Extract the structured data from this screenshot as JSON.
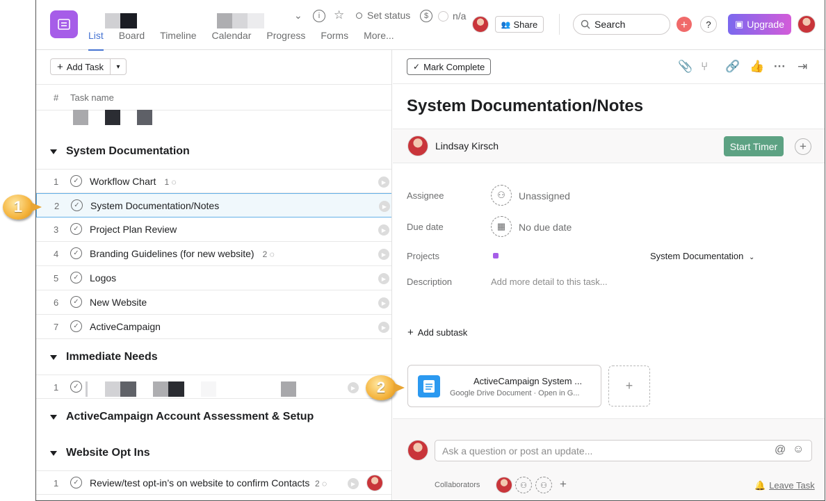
{
  "header": {
    "tabs": [
      "List",
      "Board",
      "Timeline",
      "Calendar",
      "Progress",
      "Forms",
      "More..."
    ],
    "set_status": "Set status",
    "cost": "n/a",
    "share": "Share",
    "search": "Search",
    "help": "?",
    "upgrade": "Upgrade"
  },
  "list": {
    "add_task": "Add Task",
    "col_hash": "#",
    "col_name": "Task name",
    "sections": [
      {
        "title": "System Documentation"
      },
      {
        "title": "Immediate Needs"
      },
      {
        "title": "ActiveCampaign Account Assessment & Setup"
      },
      {
        "title": "Website Opt Ins"
      }
    ],
    "tasks_sysdoc": [
      {
        "num": "1",
        "name": "Workflow Chart",
        "comments": "1"
      },
      {
        "num": "2",
        "name": "System Documentation/Notes",
        "comments": ""
      },
      {
        "num": "3",
        "name": "Project Plan Review",
        "comments": ""
      },
      {
        "num": "4",
        "name": "Branding Guidelines (for new website)",
        "comments": "2"
      },
      {
        "num": "5",
        "name": "Logos",
        "comments": ""
      },
      {
        "num": "6",
        "name": "New Website",
        "comments": ""
      },
      {
        "num": "7",
        "name": "ActiveCampaign",
        "comments": ""
      }
    ],
    "immediate_num": "1",
    "optin_task": {
      "num": "1",
      "name": "Review/test opt-in’s on website to confirm Contacts a",
      "comments": "2"
    }
  },
  "detail": {
    "mark_complete": "Mark Complete",
    "title": "System Documentation/Notes",
    "owner": "Lindsay Kirsch",
    "start_timer": "Start Timer",
    "assignee_label": "Assignee",
    "assignee_value": "Unassigned",
    "due_label": "Due date",
    "due_value": "No due date",
    "projects_label": "Projects",
    "project_name": "System Documentation",
    "description_label": "Description",
    "description_placeholder": "Add more detail to this task...",
    "add_subtask": "Add subtask",
    "attachment_title": "ActiveCampaign System ...",
    "attachment_sub": "Google Drive Document · Open in G...",
    "comment_placeholder": "Ask a question or post an update...",
    "collaborators": "Collaborators",
    "leave_task": "Leave Task"
  },
  "callouts": {
    "one": "1",
    "two": "2"
  },
  "colors": {
    "accent": "#4573d2",
    "timer": "#5da283",
    "upgrade": "#9b5de5",
    "app_icon": "#a65de8",
    "callout": "#f4b23b"
  }
}
